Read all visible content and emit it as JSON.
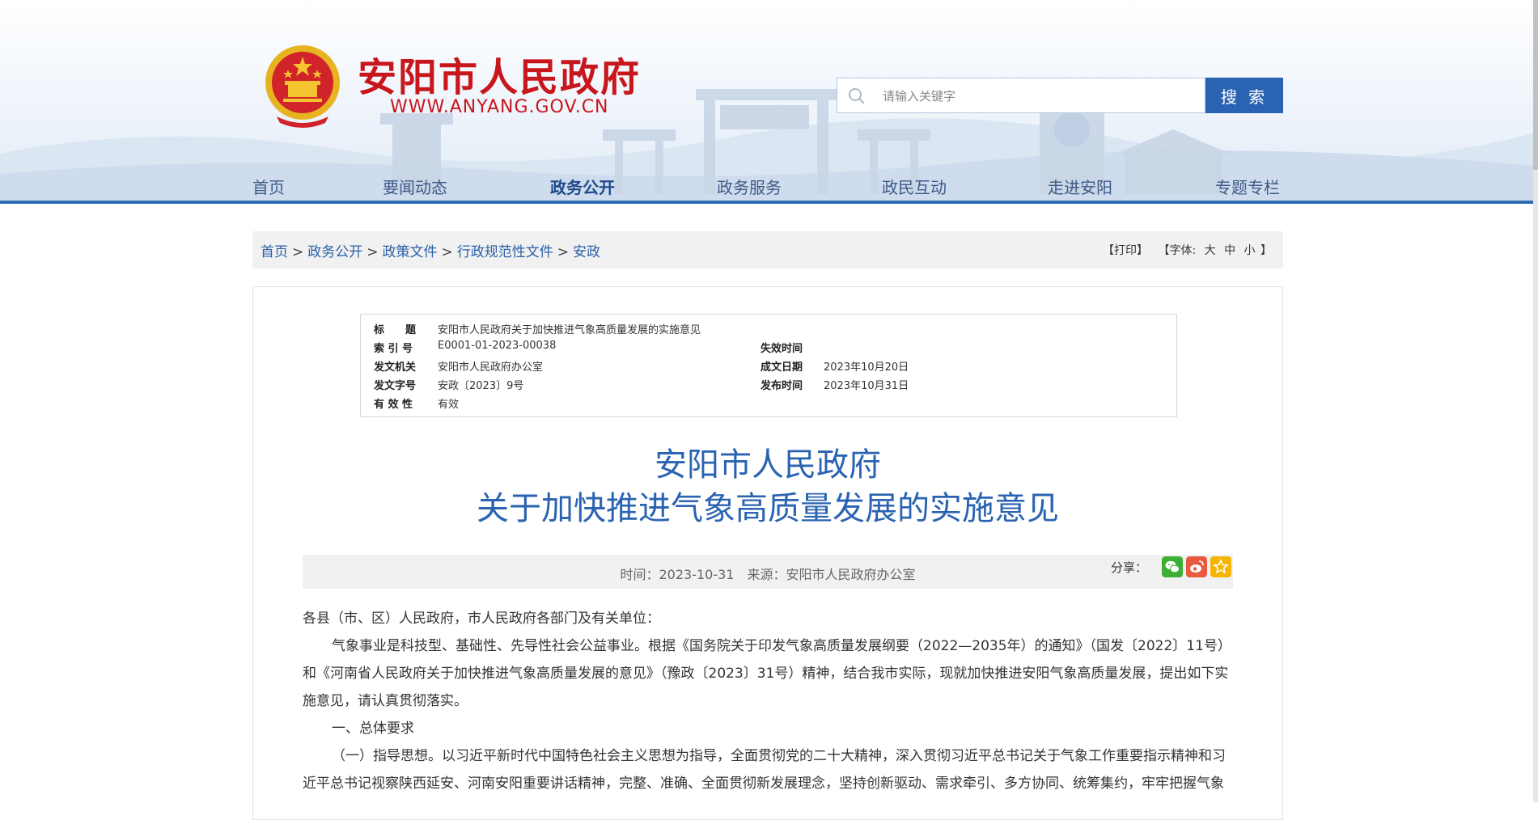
{
  "header": {
    "site_title": "安阳市人民政府",
    "site_domain": "WWW.ANYANG.GOV.CN",
    "colors": {
      "brand_red": "#c8161d",
      "brand_blue": "#2a63b1",
      "nav_text": "#3d5a86"
    }
  },
  "search": {
    "placeholder": "请输入关键字",
    "button_label": "搜 索",
    "icon": "search-icon"
  },
  "nav": {
    "items": [
      {
        "label": "首页"
      },
      {
        "label": "要闻动态"
      },
      {
        "label": "政务公开",
        "active": true
      },
      {
        "label": "政务服务"
      },
      {
        "label": "政民互动"
      },
      {
        "label": "走进安阳"
      },
      {
        "label": "专题专栏"
      }
    ]
  },
  "breadcrumb": {
    "items": [
      "首页",
      "政务公开",
      "政策文件",
      "行政规范性文件",
      "安政"
    ],
    "separator": ">"
  },
  "tools": {
    "print_label": "【打印】",
    "font_prefix": "【字体:",
    "font_large": "大",
    "font_medium": "中",
    "font_small": "小",
    "font_suffix": "】"
  },
  "meta": {
    "title_label": "标　　题",
    "title_value": "安阳市人民政府关于加快推进气象高质量发展的实施意见",
    "index_label": "索 引 号",
    "index_value": "E0001-01-2023-00038",
    "expire_label": "失效时间",
    "expire_value": "",
    "issuer_label": "发文机关",
    "issuer_value": "安阳市人民政府办公室",
    "written_label": "成文日期",
    "written_value": "2023年10月20日",
    "docno_label": "发文字号",
    "docno_value": "安政〔2023〕9号",
    "publish_label": "发布时间",
    "publish_value": "2023年10月31日",
    "valid_label": "有 效 性",
    "valid_value": "有效"
  },
  "document": {
    "title_line1": "安阳市人民政府",
    "title_line2": "关于加快推进气象高质量发展的实施意见",
    "time": "时间：2023-10-31",
    "source": "来源：安阳市人民政府办公室",
    "share_label": "分享：",
    "share_icons": [
      "wechat-icon",
      "weibo-icon",
      "favorite-icon"
    ],
    "salutation": "各县（市、区）人民政府，市人民政府各部门及有关单位：",
    "para1": "气象事业是科技型、基础性、先导性社会公益事业。根据《国务院关于印发气象高质量发展纲要（2022—2035年）的通知》（国发〔2022〕11号）和《河南省人民政府关于加快推进气象高质量发展的意见》（豫政〔2023〕31号）精神，结合我市实际，现就加快推进安阳气象高质量发展，提出如下实施意见，请认真贯彻落实。",
    "section1": "一、总体要求",
    "para2": "（一）指导思想。以习近平新时代中国特色社会主义思想为指导，全面贯彻党的二十大精神，深入贯彻习近平总书记关于气象工作重要指示精神和习近平总书记视察陕西延安、河南安阳重要讲话精神，完整、准确、全面贯彻新发展理念，坚持创新驱动、需求牵引、多方协同、统筹集约，牢牢把握气象"
  }
}
